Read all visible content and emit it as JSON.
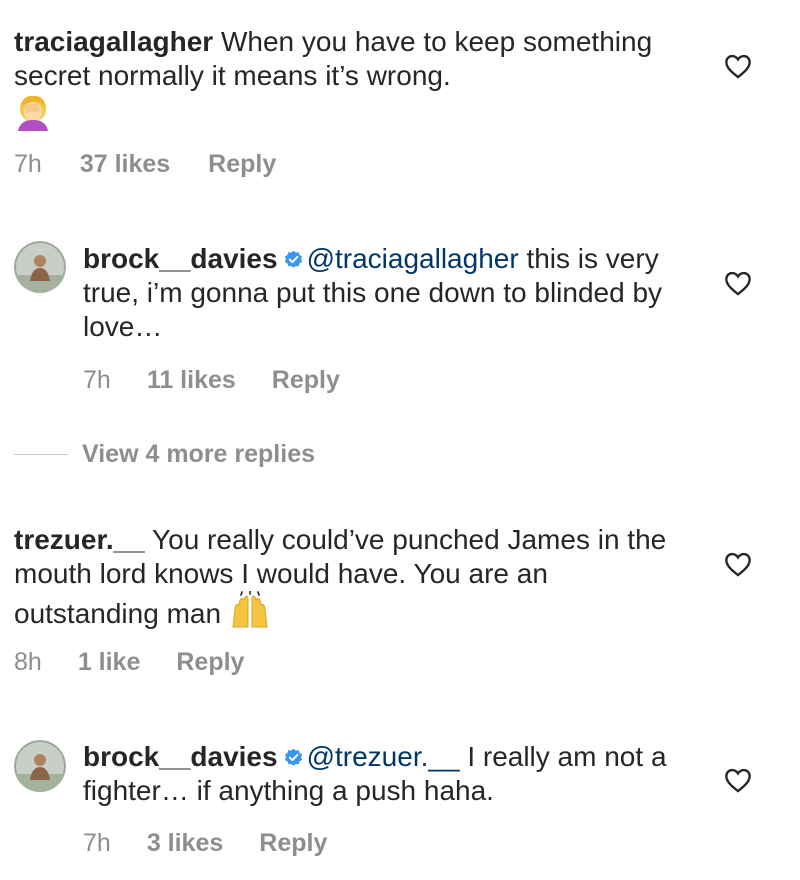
{
  "comments": [
    {
      "username": "traciagallagher",
      "text": "When you have to keep something secret normally it means it’s wrong.",
      "emoji": "face-palm-emoji",
      "time": "7h",
      "likes": "37 likes",
      "reply": "Reply"
    },
    {
      "username": "brock__davies",
      "verified": true,
      "mention": "@traciagallagher",
      "text": "this is very true, i’m gonna put this one down to blinded by love…",
      "time": "7h",
      "likes": "11 likes",
      "reply": "Reply"
    },
    {
      "username": "trezuer.__",
      "text": "You really could’ve punched James in the mouth lord knows I would have. You are an outstanding man",
      "emoji": "raising-hands-emoji",
      "time": "8h",
      "likes": "1 like",
      "reply": "Reply"
    },
    {
      "username": "brock__davies",
      "verified": true,
      "mention": "@trezuer.__",
      "text": "I really am not a fighter… if anything a push haha.",
      "time": "7h",
      "likes": "3 likes",
      "reply": "Reply"
    }
  ],
  "view_more_replies": "View 4 more replies",
  "icons": {
    "like": "heart-outline-icon",
    "verified": "verified-badge-icon"
  },
  "colors": {
    "text": "#262626",
    "secondary": "#8e8e8e",
    "mention": "#00376b",
    "verified": "#3897f0"
  }
}
